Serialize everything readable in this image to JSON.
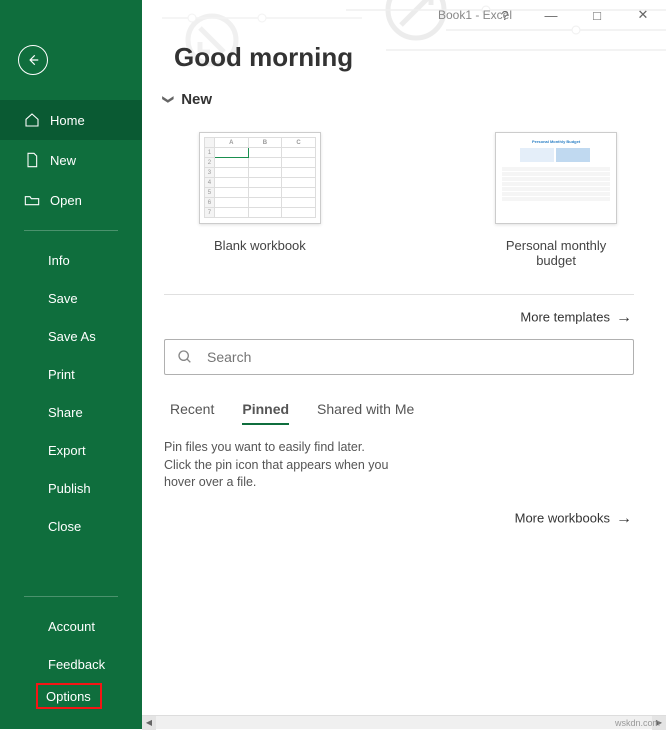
{
  "window": {
    "title": "Book1 - Excel"
  },
  "sidebar": {
    "home": "Home",
    "new": "New",
    "open": "Open",
    "info": "Info",
    "save": "Save",
    "saveas": "Save As",
    "print": "Print",
    "share": "Share",
    "export": "Export",
    "publish": "Publish",
    "close": "Close",
    "account": "Account",
    "feedback": "Feedback",
    "options": "Options"
  },
  "main": {
    "greeting": "Good morning",
    "new_section": "New",
    "templates": {
      "blank": "Blank workbook",
      "budget": "Personal monthly budget",
      "budget_thumb_title": "Personal Monthly Budget"
    },
    "more_templates": "More templates",
    "more_workbooks": "More workbooks",
    "search_placeholder": "Search",
    "tabs": {
      "recent": "Recent",
      "pinned": "Pinned",
      "shared": "Shared with Me"
    },
    "pinned_hint": "Pin files you want to easily find later. Click the pin icon that appears when you hover over a file."
  },
  "watermark": "wskdn.com"
}
